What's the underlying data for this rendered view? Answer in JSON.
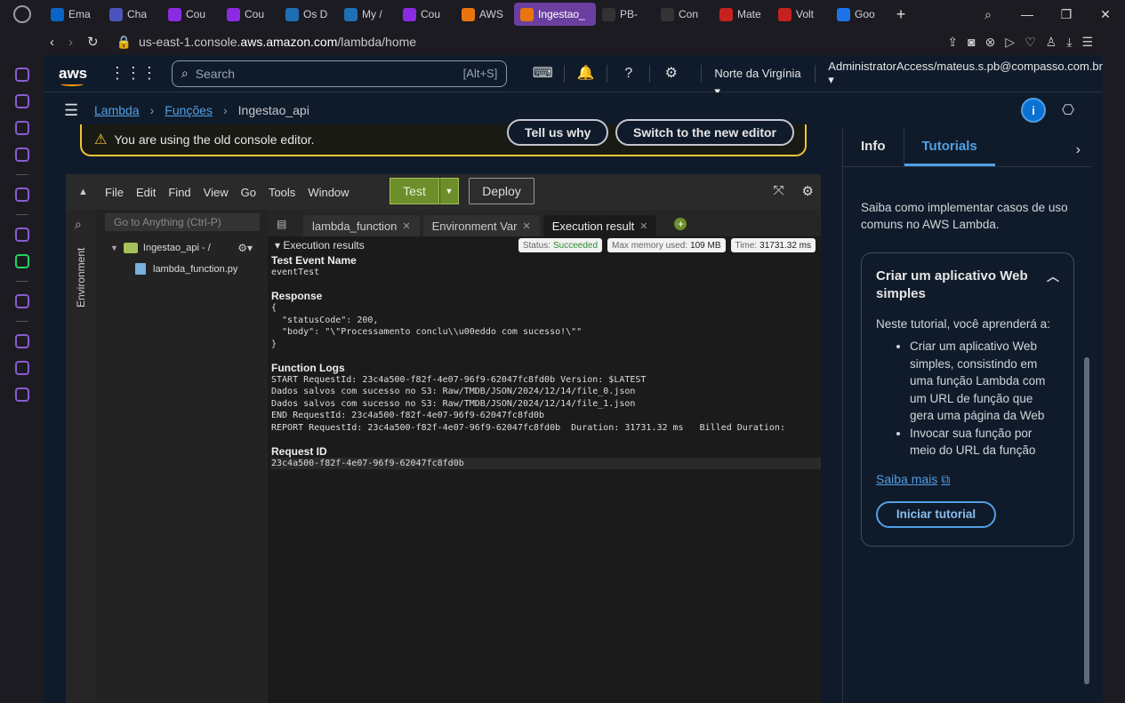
{
  "browser": {
    "tabs": [
      {
        "label": "Ema",
        "color": "#0a64c8"
      },
      {
        "label": "Cha",
        "color": "#4b53bc"
      },
      {
        "label": "Cou",
        "color": "#8a2be2"
      },
      {
        "label": "Cou",
        "color": "#8a2be2"
      },
      {
        "label": "Os D",
        "color": "#1f6fb5"
      },
      {
        "label": "My /",
        "color": "#1f6fb5"
      },
      {
        "label": "Cou",
        "color": "#8a2be2"
      },
      {
        "label": "AWS",
        "color": "#e8750f"
      },
      {
        "label": "Ingestao_",
        "color": "#e8750f",
        "active": true
      },
      {
        "label": "PB-",
        "color": "#333333"
      },
      {
        "label": "Con",
        "color": "#333333"
      },
      {
        "label": "Mate",
        "color": "#c5221f"
      },
      {
        "label": "Volt",
        "color": "#c5221f"
      },
      {
        "label": "Goo",
        "color": "#1a73e8"
      }
    ],
    "url_prefix": "us-east-1.console.",
    "url_host": "aws.amazon.com",
    "url_path": "/lambda/home"
  },
  "aws": {
    "search_placeholder": "Search",
    "search_shortcut": "[Alt+S]",
    "region": "Norte da Virgínia",
    "account": "AdministratorAccess/mateus.s.pb@compasso.com.br",
    "breadcrumbs": {
      "lambda": "Lambda",
      "functions": "Funções",
      "current": "Ingestao_api"
    },
    "banner": {
      "text": "You are using the old console editor.",
      "tell_us": "Tell us why",
      "switch": "Switch to the new editor"
    }
  },
  "ide": {
    "menu": [
      "File",
      "Edit",
      "Find",
      "View",
      "Go",
      "Tools",
      "Window"
    ],
    "test_label": "Test",
    "deploy_label": "Deploy",
    "goto_placeholder": "Go to Anything (Ctrl-P)",
    "env_label": "Environment",
    "tree_root": "Ingestao_api - /",
    "tree_file": "lambda_function.py",
    "tabs": [
      "lambda_function",
      "Environment Var",
      "Execution result"
    ],
    "exec_title": "Execution results",
    "status_label": "Status:",
    "status_value": "Succeeded",
    "memory_label": "Max memory used:",
    "memory_value": "109 MB",
    "time_label": "Time:",
    "time_value": "31731.32 ms",
    "test_event_h": "Test Event Name",
    "test_event": "eventTest",
    "response_h": "Response",
    "response": "{\n  \"statusCode\": 200,\n  \"body\": \"\\\"Processamento conclu\\\\u00eddo com sucesso!\\\"\"\n}",
    "logs_h": "Function Logs",
    "logs": "START RequestId: 23c4a500-f82f-4e07-96f9-62047fc8fd0b Version: $LATEST\nDados salvos com sucesso no S3: Raw/TMDB/JSON/2024/12/14/file_0.json\nDados salvos com sucesso no S3: Raw/TMDB/JSON/2024/12/14/file_1.json\nEND RequestId: 23c4a500-f82f-4e07-96f9-62047fc8fd0b\nREPORT RequestId: 23c4a500-f82f-4e07-96f9-62047fc8fd0b  Duration: 31731.32 ms   Billed Duration:",
    "reqid_h": "Request ID",
    "reqid": "23c4a500-f82f-4e07-96f9-62047fc8fd0b"
  },
  "panel": {
    "tab_info": "Info",
    "tab_tutorials": "Tutorials",
    "intro": "Saiba como implementar casos de uso comuns no AWS Lambda.",
    "card_title": "Criar um aplicativo Web simples",
    "card_lead": "Neste tutorial, você aprenderá a:",
    "bullets": [
      "Criar um aplicativo Web simples, consistindo em uma função Lambda com um URL de função que gera uma página da Web",
      "Invocar sua função por meio do URL da função"
    ],
    "learn_more": "Saiba mais",
    "start": "Iniciar tutorial"
  }
}
